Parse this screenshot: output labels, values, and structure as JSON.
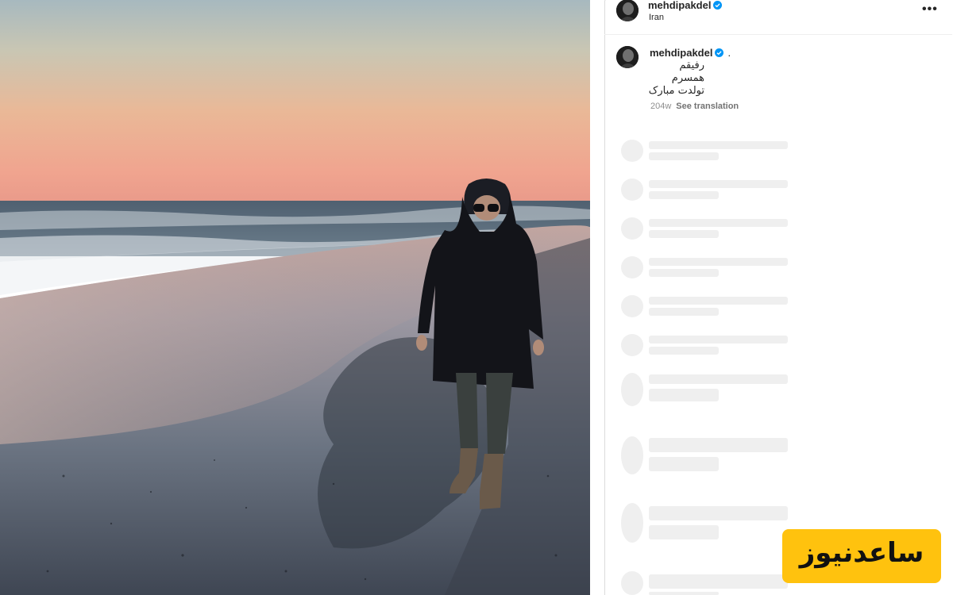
{
  "post": {
    "username": "mehdipakdel",
    "location": "Iran",
    "caption_lines": [
      "رفیقم",
      "همسرم",
      "تولدت مبارک"
    ],
    "caption_suffix": ".",
    "age": "204w",
    "see_translation": "See translation",
    "more_label": "•••"
  },
  "watermark": {
    "text": "ساعدنیوز"
  },
  "colors": {
    "verified": "#0095f6",
    "skeleton": "#efefef",
    "watermark_bg": "#ffc20e"
  }
}
